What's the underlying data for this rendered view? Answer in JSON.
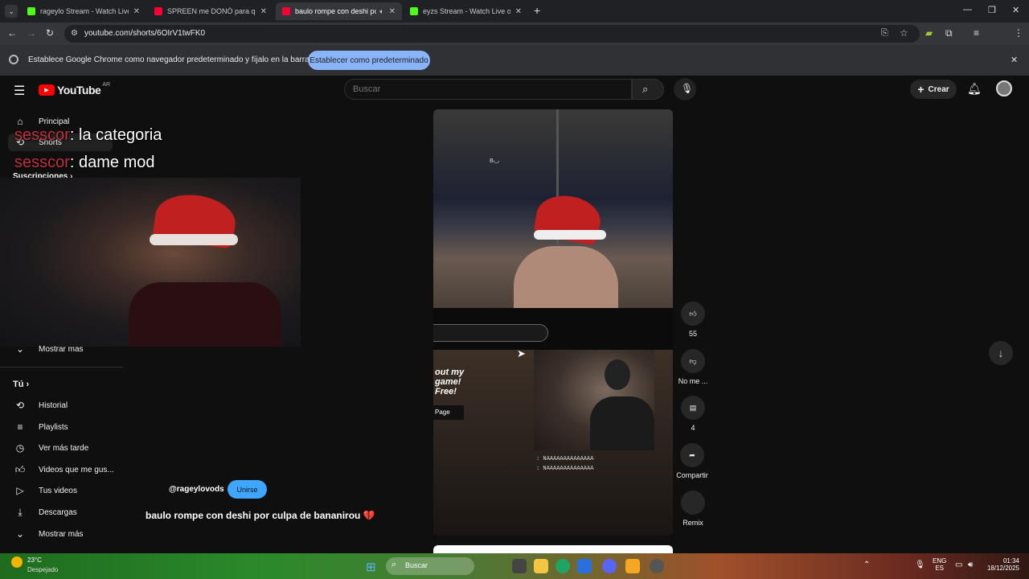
{
  "browser": {
    "tabs": [
      {
        "title": "rageylo Stream - Watch Live on K",
        "favicon_color": "#53fc18",
        "active": false
      },
      {
        "title": "SPREEN me DONÓ para que ES",
        "favicon_color": "#ff0033",
        "active": false
      },
      {
        "title": "baulo rompe con deshi por",
        "favicon_color": "#ff0033",
        "active": true
      },
      {
        "title": "eyzs Stream - Watch Live on Kic",
        "favicon_color": "#53fc18",
        "active": false
      }
    ],
    "url": "youtube.com/shorts/6OIrV1twFK0",
    "infobar_message": "Establece Google Chrome como navegador predeterminado y fíjalo en la barra de tareas",
    "infobar_button": "Establecer como predeterminado"
  },
  "youtube": {
    "logo_text": "YouTube",
    "region": "AR",
    "search_placeholder": "Buscar",
    "create_label": "Crear"
  },
  "sidebar": {
    "top": [
      {
        "label": "Principal",
        "icon": "home-icon"
      },
      {
        "label": "Shorts",
        "icon": "shorts-icon"
      }
    ],
    "subscriptions_label": "Suscripciones",
    "show_more_1": "Mostrar mas",
    "you_label": "Tú",
    "you_items": [
      {
        "label": "Historial",
        "icon": "history-icon"
      },
      {
        "label": "Playlists",
        "icon": "playlist-icon"
      },
      {
        "label": "Ver más tarde",
        "icon": "clock-icon"
      },
      {
        "label": "Videos que me gus...",
        "icon": "like-icon"
      },
      {
        "label": "Tus videos",
        "icon": "play-icon"
      },
      {
        "label": "Descargas",
        "icon": "download-icon"
      }
    ],
    "show_more_2": "Mostrar más"
  },
  "overlay_chat": [
    {
      "user": "sesscor",
      "text": ": la categoria"
    },
    {
      "user": "sesscor",
      "text": ": dame mod"
    }
  ],
  "player": {
    "stream_chat": [
      ": NAAAAAAAAAAAAAA",
      ": NAAAAAAAAAAAAAA"
    ],
    "game_text": "out my game! Free!",
    "page_label": "Page"
  },
  "actions": {
    "likes": "55",
    "dislike_label": "No me ...",
    "comments": "4",
    "share_label": "Compartir",
    "remix_label": "Remix"
  },
  "video": {
    "channel": "@rageylovods",
    "join_label": "Unirse",
    "title": "baulo rompe con deshi por culpa de bananirou 💔"
  },
  "taskbar": {
    "weather_temp": "23°C",
    "weather_desc": "Despejado",
    "search_label": "Buscar",
    "lang_line1": "ENG",
    "lang_line2": "ES",
    "time": "01:34",
    "date": "18/12/2025"
  }
}
